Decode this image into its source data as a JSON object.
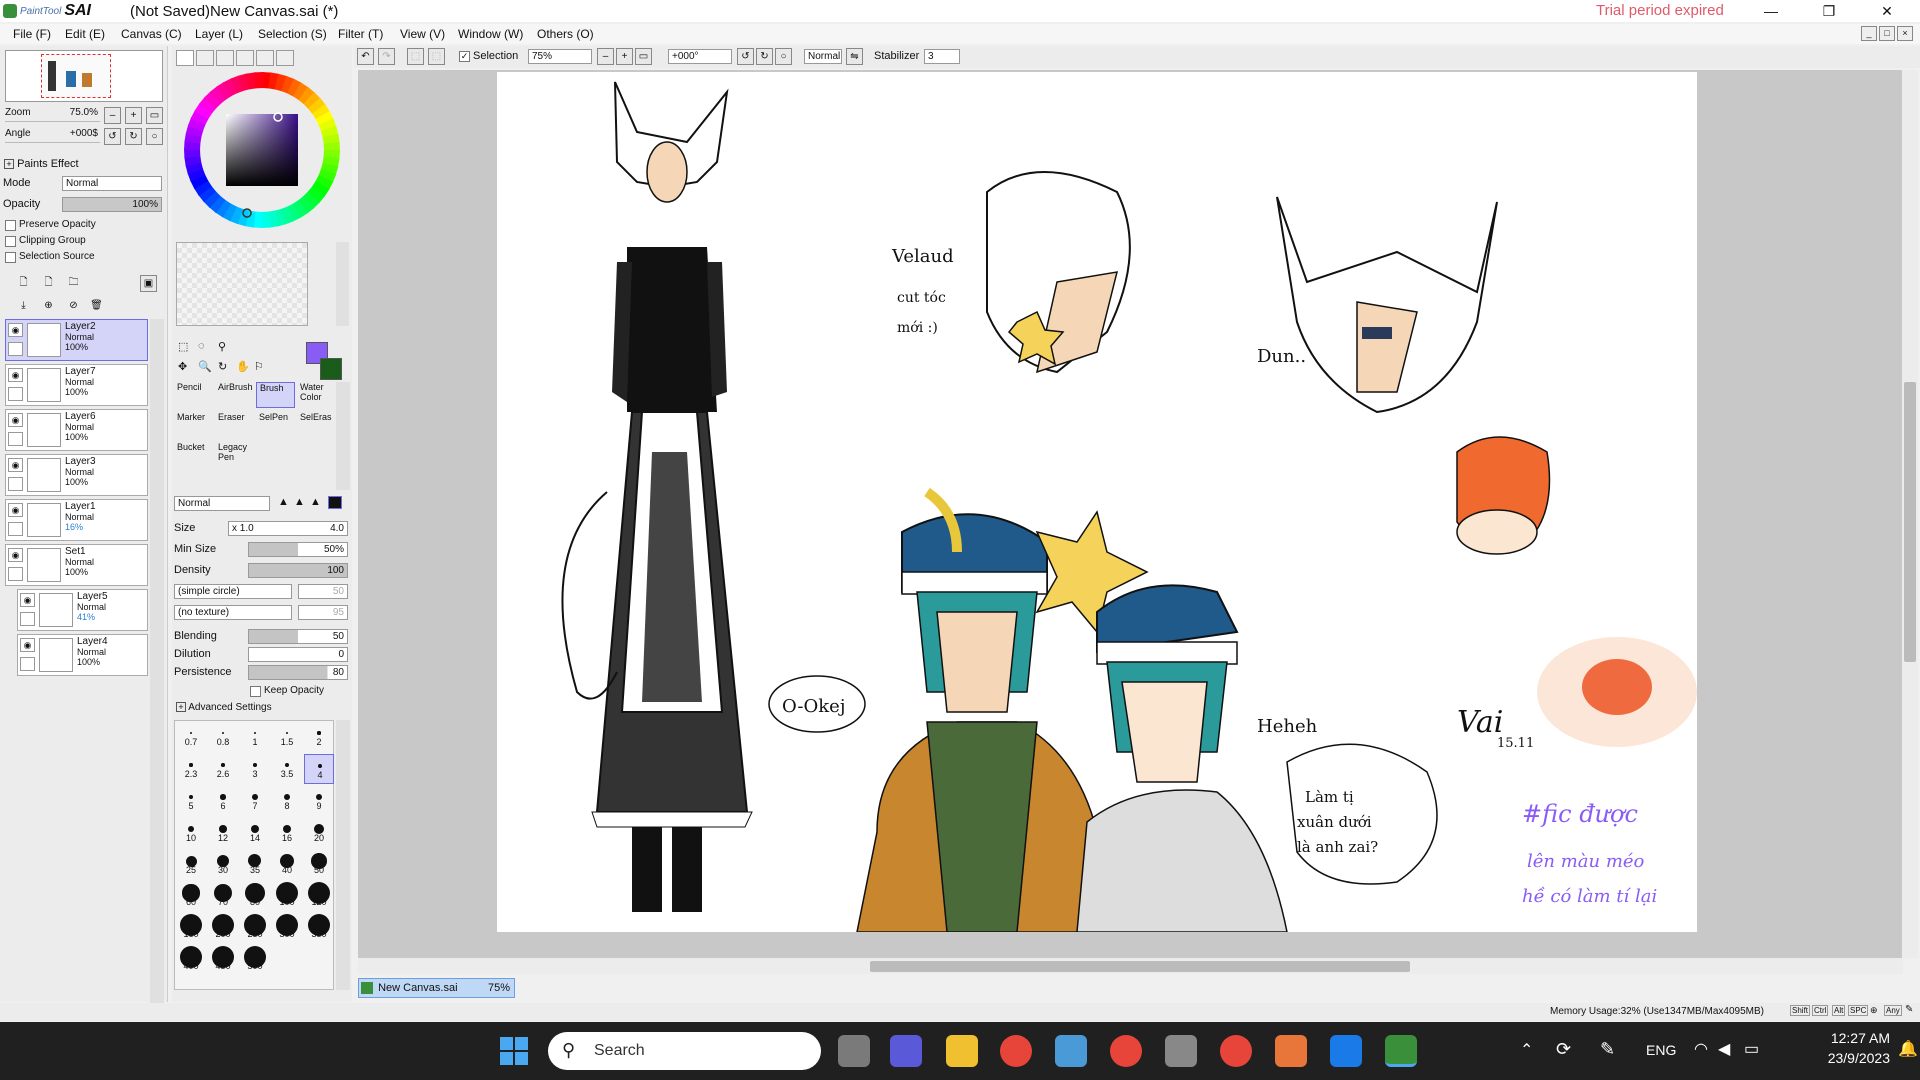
{
  "titlebar": {
    "app_small": "PaintTool",
    "app_big": "SAI",
    "document_title": "(Not Saved)New Canvas.sai (*)",
    "trial_notice": "Trial period expired",
    "minimize": "—",
    "restore": "❐",
    "close": "✕"
  },
  "menu": [
    "File (F)",
    "Edit (E)",
    "Canvas (C)",
    "Layer (L)",
    "Selection (S)",
    "Filter (T)",
    "View (V)",
    "Window (W)",
    "Others (O)"
  ],
  "navigator": {
    "zoom_label": "Zoom",
    "zoom_value": "75.0%",
    "angle_label": "Angle",
    "angle_value": "+000$"
  },
  "paint_effect": {
    "header": "Paints Effect",
    "mode_label": "Mode",
    "mode_value": "Normal",
    "opacity_label": "Opacity",
    "opacity_value": "100%",
    "preserve_opacity": "Preserve Opacity",
    "clipping_group": "Clipping Group",
    "selection_source": "Selection Source"
  },
  "layers": [
    {
      "name": "Layer2",
      "mode": "Normal",
      "opacity": "100%",
      "selected": true,
      "opacity_color": "#111111"
    },
    {
      "name": "Layer7",
      "mode": "Normal",
      "opacity": "100%",
      "selected": false,
      "opacity_color": "#111111"
    },
    {
      "name": "Layer6",
      "mode": "Normal",
      "opacity": "100%",
      "selected": false,
      "opacity_color": "#111111"
    },
    {
      "name": "Layer3",
      "mode": "Normal",
      "opacity": "100%",
      "selected": false,
      "opacity_color": "#111111"
    },
    {
      "name": "Layer1",
      "mode": "Normal",
      "opacity": "16%",
      "selected": false,
      "opacity_color": "#2a7fd4"
    },
    {
      "name": "Set1",
      "mode": "Normal",
      "opacity": "100%",
      "selected": false,
      "opacity_color": "#111111"
    },
    {
      "name": "Layer5",
      "mode": "Normal",
      "opacity": "41%",
      "selected": false,
      "opacity_color": "#2a7fd4"
    },
    {
      "name": "Layer4",
      "mode": "Normal",
      "opacity": "100%",
      "selected": false,
      "opacity_color": "#111111"
    }
  ],
  "tools": [
    {
      "label": "Pencil",
      "selected": false
    },
    {
      "label": "AirBrush",
      "selected": false
    },
    {
      "label": "Brush",
      "selected": true
    },
    {
      "label": "Water Color",
      "selected": false
    },
    {
      "label": "Marker",
      "selected": false
    },
    {
      "label": "Eraser",
      "selected": false
    },
    {
      "label": "SelPen",
      "selected": false
    },
    {
      "label": "SelEras",
      "selected": false
    },
    {
      "label": "Bucket",
      "selected": false
    },
    {
      "label": "Legacy Pen",
      "selected": false
    }
  ],
  "brush": {
    "blend_mode": "Normal",
    "size_label": "Size",
    "size_mult": "x 1.0",
    "size_value": "4.0",
    "min_size_label": "Min Size",
    "min_size_value": "50%",
    "min_size_fraction": 0.5,
    "density_label": "Density",
    "density_value": "100",
    "density_fraction": 1.0,
    "shape": "(simple circle)",
    "shape_value": "50",
    "texture": "(no texture)",
    "texture_value": "95",
    "blending_label": "Blending",
    "blending_value": "50",
    "blending_fraction": 0.5,
    "dilution_label": "Dilution",
    "dilution_value": "0",
    "dilution_fraction": 0.0,
    "persistence_label": "Persistence",
    "persistence_value": "80",
    "persistence_fraction": 0.8,
    "keep_opacity": "Keep Opacity",
    "advanced": "Advanced Settings"
  },
  "brush_sizes": [
    "0.7",
    "0.8",
    "1",
    "1.5",
    "2",
    "2.3",
    "2.6",
    "3",
    "3.5",
    "4",
    "5",
    "6",
    "7",
    "8",
    "9",
    "10",
    "12",
    "14",
    "16",
    "20",
    "25",
    "30",
    "35",
    "40",
    "50",
    "60",
    "70",
    "80",
    "100",
    "120",
    "160",
    "200",
    "250",
    "300",
    "350",
    "400",
    "450",
    "500"
  ],
  "selected_brush_size": "4",
  "colors": {
    "primary": "#8a5cf6",
    "secondary": "#1a5c1a",
    "hue_box": "#3b0f8a",
    "accent": "#6d6de0"
  },
  "topbar": {
    "selection_label": "Selection",
    "zoom": "75%",
    "rotation": "+000°",
    "mode": "Normal",
    "stabilizer_label": "Stabilizer",
    "stabilizer_value": "3"
  },
  "doc_tab": {
    "name": "New Canvas.sai",
    "zoom": "75%"
  },
  "status": {
    "memory": "Memory Usage:32% (Use1347MB/Max4095MB)",
    "keys": [
      "Shift",
      "Ctrl",
      "Alt",
      "SPC"
    ],
    "any": "Any"
  },
  "drawing_text": {
    "note1": "Velaud\ncut tóc\nmới :)\n->",
    "note2": "Dun..",
    "note3": "O-Okej",
    "note4": "Heheh",
    "note5": "Làm tị\nxuân dưới\nlà anh zai?",
    "signature": "Vai\n15.11",
    "hashtag": "#fic được\nlên màu méo\nhề có làm tí lại"
  },
  "taskbar": {
    "search_placeholder": "Search",
    "lang": "ENG",
    "time": "12:27 AM",
    "date": "23/9/2023"
  }
}
